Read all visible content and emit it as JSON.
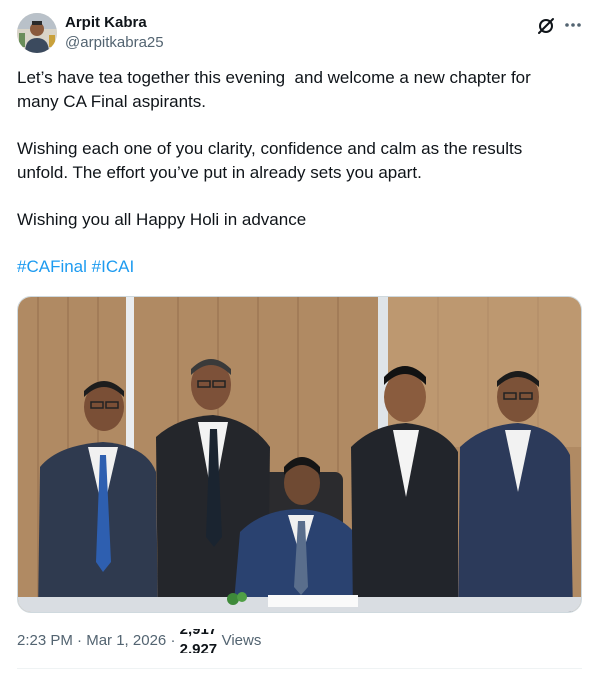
{
  "author": {
    "name": "Arpit Kabra",
    "handle": "@arpitkabra25"
  },
  "icons": {
    "grok": "grok-slash-icon",
    "more": "more-dots-icon"
  },
  "tweet": {
    "paragraphs": [
      "Let’s have tea together this evening  and welcome a new chapter for many CA Final aspirants.",
      "Wishing each one of you clarity, confidence and calm as the results unfold. The effort you’ve put in already sets you apart.",
      "Wishing you all Happy Holi in advance"
    ],
    "hashtags": [
      "#CAFinal",
      "#ICAI"
    ]
  },
  "media": {
    "alt": "Group photo of five men in suits, one seated at a table signing a document"
  },
  "meta": {
    "time": "2:23 PM",
    "separator1": "·",
    "date": "Mar 1, 2026",
    "separator2": "·",
    "views_count": "2,917",
    "views_count_next": "2,927",
    "views_label": "Views"
  },
  "colors": {
    "text": "#0f1419",
    "secondary": "#536471",
    "link": "#1d9bf0",
    "border": "#cfd9de"
  }
}
